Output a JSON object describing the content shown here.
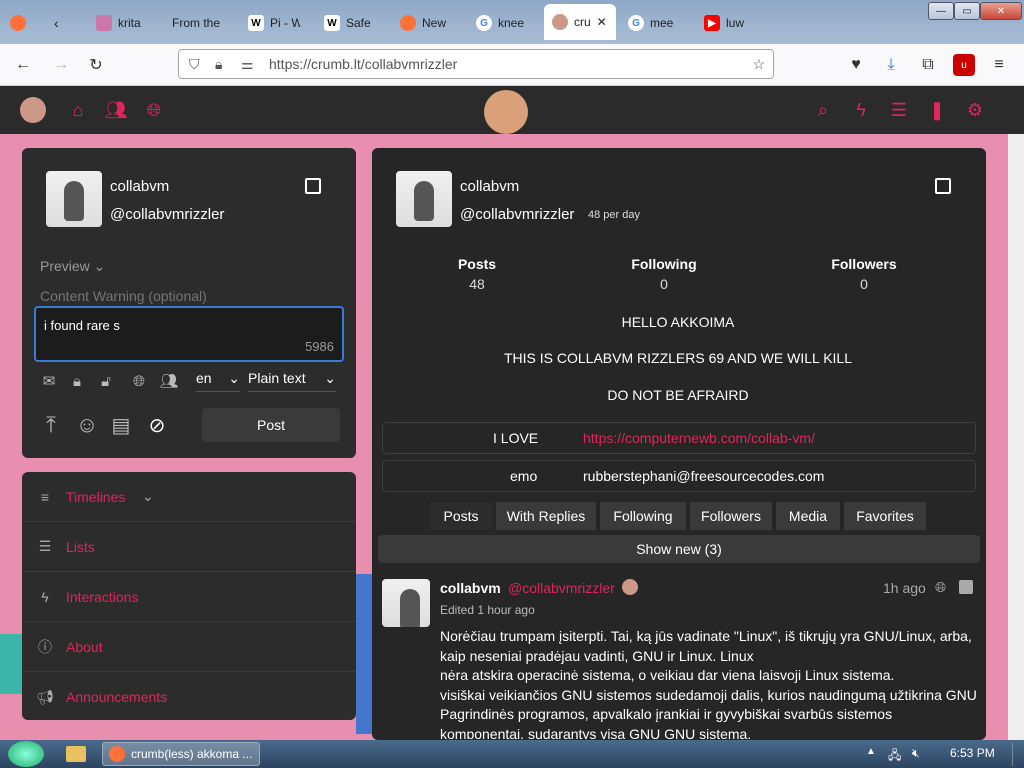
{
  "browser": {
    "tabs": [
      {
        "label": "krita",
        "icon": "krita-icon"
      },
      {
        "label": "From the",
        "icon": "page-icon"
      },
      {
        "label": "Pi - W",
        "icon": "wikipedia-icon"
      },
      {
        "label": "Safe",
        "icon": "wikipedia-icon"
      },
      {
        "label": "New",
        "icon": "firefox-icon"
      },
      {
        "label": "knee",
        "icon": "google-icon"
      },
      {
        "label": "cru",
        "icon": "cookie-icon"
      },
      {
        "label": "mee",
        "icon": "google-icon"
      },
      {
        "label": "luw",
        "icon": "youtube-icon"
      }
    ],
    "url": "https://crumb.lt/collabvmrizzler"
  },
  "compose": {
    "name": "collabvm",
    "handle": "@collabvmrizzler",
    "preview_label": "Preview",
    "cw_placeholder": "Content Warning (optional)",
    "text": "i found rare s",
    "char_count": "5986",
    "language": "en",
    "format": "Plain text",
    "post_label": "Post"
  },
  "nav": {
    "items": [
      {
        "label": "Timelines"
      },
      {
        "label": "Lists"
      },
      {
        "label": "Interactions"
      },
      {
        "label": "About"
      },
      {
        "label": "Announcements"
      }
    ]
  },
  "profile": {
    "name": "collabvm",
    "handle": "@collabvmrizzler",
    "rate": "48 per day",
    "stats": [
      {
        "label": "Posts",
        "value": "48"
      },
      {
        "label": "Following",
        "value": "0"
      },
      {
        "label": "Followers",
        "value": "0"
      }
    ],
    "bio": [
      "HELLO AKKOIMA",
      "THIS IS COLLABVM RIZZLERS 69 AND WE WILL KILL",
      "DO NOT BE AFRAIRD"
    ],
    "fields": [
      {
        "key": "I LOVE",
        "value": "https://computernewb.com/collab-vm/"
      },
      {
        "key": "emo",
        "value": "rubberstephani@freesourcecodes.com"
      }
    ],
    "tabs": [
      "Posts",
      "With Replies",
      "Following",
      "Followers",
      "Media",
      "Favorites"
    ],
    "show_new": "Show new (3)"
  },
  "post": {
    "name": "collabvm",
    "handle": "@collabvmrizzler",
    "time": "1h ago",
    "edited": "Edited 1 hour ago",
    "lines": [
      "Norėčiau trumpam įsiterpti. Tai, ką jūs vadinate \"Linux\", iš tikrųjų yra GNU/Linux, arba,",
      "kaip neseniai pradėjau vadinti, GNU ir Linux. Linux",
      "nėra atskira operacinė sistema, o veikiau dar viena laisvoji Linux sistema.",
      "visiškai veikiančios GNU sistemos sudedamoji dalis, kurios naudingumą užtikrina GNU",
      "Pagrindinės programos, apvalkalo įrankiai ir gyvybiškai svarbūs sistemos",
      "komponentai, sudarantys visą GNU GNU sistemą."
    ]
  },
  "taskbar": {
    "window_title": "crumb(less) akkoma ...",
    "clock": "6:53 PM"
  },
  "colors": {
    "accent": "#e0245e",
    "panel": "#2c2c2c",
    "link": "#e0245e"
  }
}
